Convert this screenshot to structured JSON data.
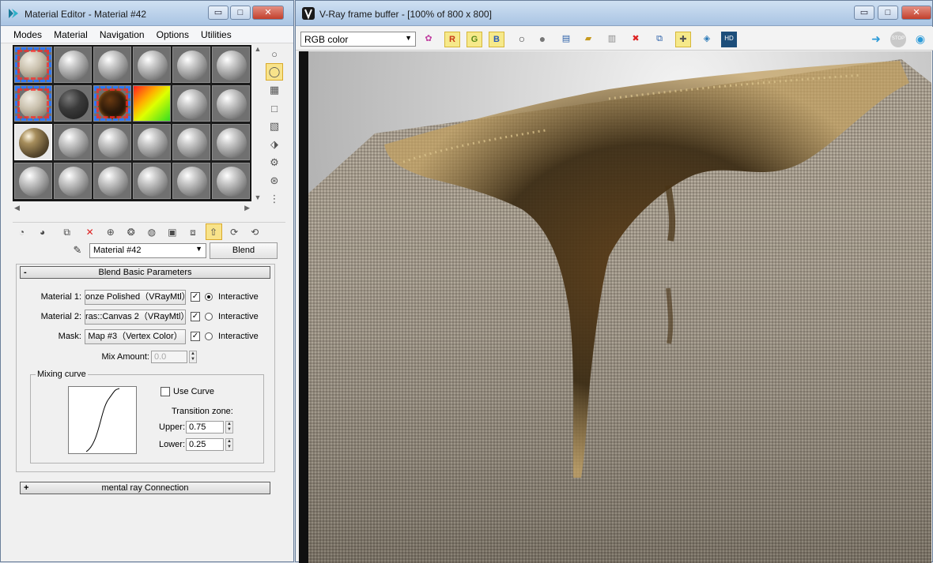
{
  "material_editor": {
    "title": "Material Editor - Material #42",
    "window_buttons": {
      "minimize": "▭",
      "maximize": "□",
      "close": "✕"
    },
    "menu": [
      "Modes",
      "Material",
      "Navigation",
      "Options",
      "Utilities"
    ],
    "sample_slots": [
      {
        "kind": "stone",
        "hatched": true
      },
      {
        "kind": "plain"
      },
      {
        "kind": "plain"
      },
      {
        "kind": "plain"
      },
      {
        "kind": "plain"
      },
      {
        "kind": "plain"
      },
      {
        "kind": "stone",
        "hatched": true
      },
      {
        "kind": "dark"
      },
      {
        "kind": "lava",
        "hatched": true
      },
      {
        "kind": "gradient"
      },
      {
        "kind": "plain"
      },
      {
        "kind": "plain"
      },
      {
        "kind": "bronze",
        "active": true
      },
      {
        "kind": "plain"
      },
      {
        "kind": "plain"
      },
      {
        "kind": "plain"
      },
      {
        "kind": "plain"
      },
      {
        "kind": "plain"
      },
      {
        "kind": "plain"
      },
      {
        "kind": "plain"
      },
      {
        "kind": "plain"
      },
      {
        "kind": "plain"
      },
      {
        "kind": "plain"
      },
      {
        "kind": "plain"
      }
    ],
    "material_name": "Material #42",
    "material_type": "Blend",
    "rollouts": {
      "blend_basic": {
        "sign": "-",
        "title": "Blend Basic Parameters"
      },
      "mental_ray": {
        "sign": "+",
        "title": "mental ray Connection"
      }
    },
    "params": {
      "material1": {
        "label": "Material 1:",
        "value": "onze Polished（VRayMtl）",
        "checked": "✓",
        "radio_on": true,
        "radio_label": "Interactive"
      },
      "material2": {
        "label": "Material 2:",
        "value": "ras::Canvas 2（VRayMtl）",
        "checked": "✓",
        "radio_on": false,
        "radio_label": "Interactive"
      },
      "mask": {
        "label": "Mask:",
        "value": "Map #3（Vertex Color）",
        "checked": "✓",
        "radio_on": false,
        "radio_label": "Interactive"
      },
      "mix_amount": {
        "label": "Mix Amount:",
        "value": "0.0"
      }
    },
    "mixing_curve": {
      "group_label": "Mixing curve",
      "use_curve_label": "Use Curve",
      "transition_zone_label": "Transition zone:",
      "upper_label": "Upper:",
      "upper_value": "0.75",
      "lower_label": "Lower:",
      "lower_value": "0.25"
    }
  },
  "vfb": {
    "title": "V-Ray frame buffer - [100% of 800 x 800]",
    "window_buttons": {
      "minimize": "▭",
      "maximize": "□",
      "close": "✕"
    },
    "channel": "RGB color",
    "channel_buttons": {
      "r": "R",
      "g": "G",
      "b": "B"
    },
    "stop_label": "STOP",
    "history_label": "HD"
  },
  "colors": {
    "title_gradient_top": "#cfe0f2",
    "active_tool": "#f8e38a",
    "close_red": "#c2402c"
  }
}
